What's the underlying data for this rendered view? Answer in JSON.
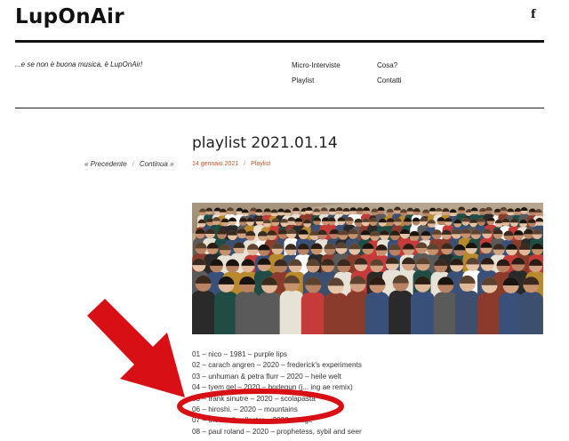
{
  "site": {
    "title": "LupOnAir",
    "tagline": "...e se non è buona musica, è LupOnAir!",
    "social_icon": "facebook-icon",
    "social_glyph": "f"
  },
  "nav": {
    "items": [
      {
        "label": "Micro-Interviste"
      },
      {
        "label": "Cosa?"
      },
      {
        "label": "Playlist"
      },
      {
        "label": "Contatti"
      }
    ]
  },
  "post": {
    "title": "playlist 2021.01.14",
    "date": "14 gennaio 2021",
    "category": "Playlist",
    "prev_label": "« Precedente",
    "next_label": "Continua »",
    "separator": "/"
  },
  "tracks": [
    "01 – nico – 1981 – purple lips",
    "02 – carach angren – 2020 – frederick's experiments",
    "03 – unhuman & petra flurr – 2020 – heile welt",
    "04 – tyem gel – 2020 – bodegun (j... ing ae remix)",
    "05 – frank sinutre – 2020 – scolapasta",
    "06 – hiroshi. – 2020 – mountains",
    "07 – the shell collector – 2020 – cage",
    "08 – paul roland – 2020 – prophetess, sybil and seer"
  ],
  "colors": {
    "accent": "#c0522d",
    "annotation_red": "#d90f16",
    "text": "#333333"
  }
}
